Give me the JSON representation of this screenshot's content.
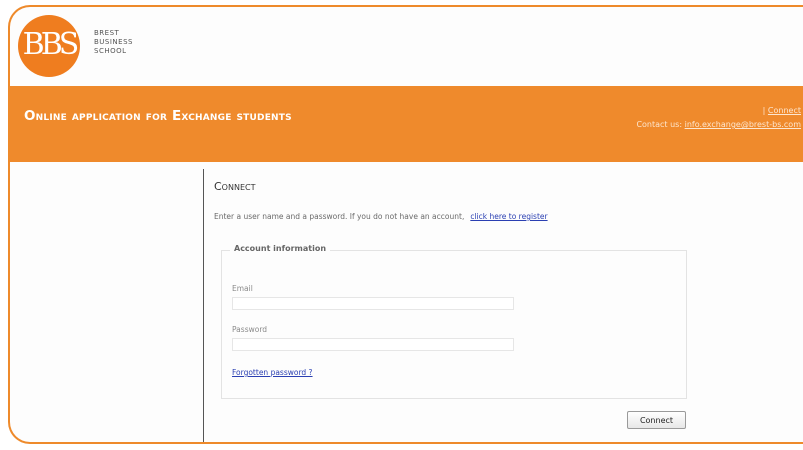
{
  "logo": {
    "letters": "BBS",
    "line1": "BREST",
    "line2": "BUSINESS",
    "line3": "SCHOOL"
  },
  "banner": {
    "title": "Online application for Exchange students",
    "separator": "| ",
    "connect_link": "Connect",
    "contact_label": "Contact us:",
    "contact_email": "info.exchange@brest-bs.com"
  },
  "page": {
    "heading": "Connect",
    "intro_text": "Enter a user name and a password. If you do not have an account,",
    "register_link": "click here to register"
  },
  "account": {
    "legend": "Account information",
    "email_label": "Email",
    "email_value": "",
    "password_label": "Password",
    "password_value": "",
    "forgot_link": "Forgotten password ?"
  },
  "actions": {
    "connect_button": "Connect"
  },
  "colors": {
    "brand_orange": "#ef8a2c",
    "link_blue": "#2a3fb2"
  }
}
